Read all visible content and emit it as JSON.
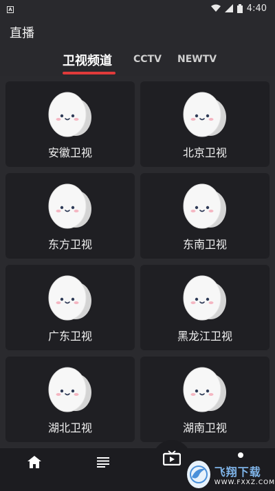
{
  "status_bar": {
    "app_badge": "A",
    "time": "4:40"
  },
  "header": {
    "title": "直播"
  },
  "tabs": [
    {
      "label": "卫视频道",
      "active": true
    },
    {
      "label": "CCTV",
      "active": false
    },
    {
      "label": "NEWTV",
      "active": false
    }
  ],
  "channels": [
    {
      "name": "安徽卫视",
      "logo": "egg-mascot-icon"
    },
    {
      "name": "北京卫视",
      "logo": "egg-mascot-icon"
    },
    {
      "name": "东方卫视",
      "logo": "egg-mascot-icon"
    },
    {
      "name": "东南卫视",
      "logo": "egg-mascot-icon"
    },
    {
      "name": "广东卫视",
      "logo": "egg-mascot-icon"
    },
    {
      "name": "黑龙江卫视",
      "logo": "egg-mascot-icon"
    },
    {
      "name": "湖北卫视",
      "logo": "egg-mascot-icon"
    },
    {
      "name": "湖南卫视",
      "logo": "egg-mascot-icon"
    }
  ],
  "bottom_nav": [
    {
      "icon": "home-icon"
    },
    {
      "icon": "list-icon"
    },
    {
      "icon": "tv-icon"
    },
    {
      "icon": "dot-icon"
    }
  ],
  "watermark": {
    "main": "飞翔下载",
    "sub": "WWW.FXXZ.COM"
  },
  "colors": {
    "accent": "#e03a3a",
    "background": "#2a2a2e",
    "card": "#1f1f23"
  }
}
